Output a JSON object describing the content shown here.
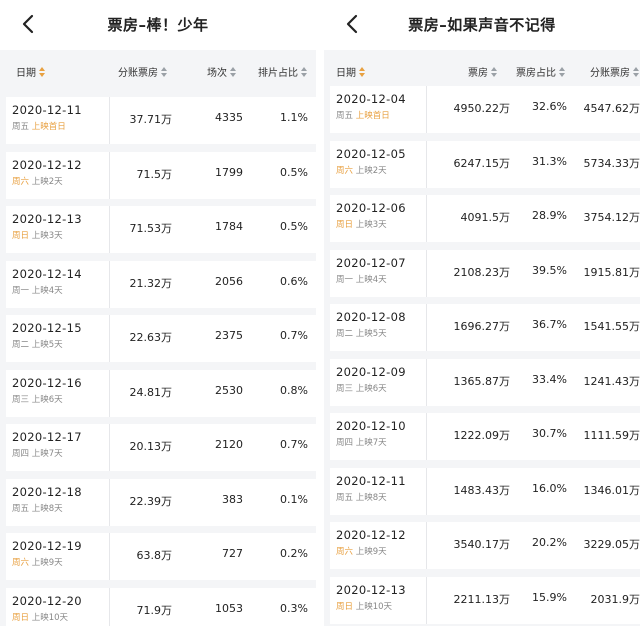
{
  "left": {
    "title": "票房–棒！少年",
    "headers": [
      "日期",
      "分账票房",
      "场次",
      "排片占比"
    ],
    "rows": [
      {
        "date": "2020-12-11",
        "weekday": "周五",
        "day": "上映首日",
        "weekend": false,
        "first": true,
        "c1": "37.71万",
        "c2": "4335",
        "c3": "1.1%"
      },
      {
        "date": "2020-12-12",
        "weekday": "周六",
        "day": "上映2天",
        "weekend": true,
        "first": false,
        "c1": "71.5万",
        "c2": "1799",
        "c3": "0.5%"
      },
      {
        "date": "2020-12-13",
        "weekday": "周日",
        "day": "上映3天",
        "weekend": true,
        "first": false,
        "c1": "71.53万",
        "c2": "1784",
        "c3": "0.5%"
      },
      {
        "date": "2020-12-14",
        "weekday": "周一",
        "day": "上映4天",
        "weekend": false,
        "first": false,
        "c1": "21.32万",
        "c2": "2056",
        "c3": "0.6%"
      },
      {
        "date": "2020-12-15",
        "weekday": "周二",
        "day": "上映5天",
        "weekend": false,
        "first": false,
        "c1": "22.63万",
        "c2": "2375",
        "c3": "0.7%"
      },
      {
        "date": "2020-12-16",
        "weekday": "周三",
        "day": "上映6天",
        "weekend": false,
        "first": false,
        "c1": "24.81万",
        "c2": "2530",
        "c3": "0.8%"
      },
      {
        "date": "2020-12-17",
        "weekday": "周四",
        "day": "上映7天",
        "weekend": false,
        "first": false,
        "c1": "20.13万",
        "c2": "2120",
        "c3": "0.7%"
      },
      {
        "date": "2020-12-18",
        "weekday": "周五",
        "day": "上映8天",
        "weekend": false,
        "first": false,
        "c1": "22.39万",
        "c2": "383",
        "c3": "0.1%"
      },
      {
        "date": "2020-12-19",
        "weekday": "周六",
        "day": "上映9天",
        "weekend": true,
        "first": false,
        "c1": "63.8万",
        "c2": "727",
        "c3": "0.2%"
      },
      {
        "date": "2020-12-20",
        "weekday": "周日",
        "day": "上映10天",
        "weekend": true,
        "first": false,
        "c1": "71.9万",
        "c2": "1053",
        "c3": "0.3%"
      }
    ]
  },
  "right": {
    "title": "票房–如果声音不记得",
    "headers": [
      "日期",
      "票房",
      "票房占比",
      "分账票房"
    ],
    "rows": [
      {
        "date": "2020-12-04",
        "weekday": "周五",
        "day": "上映首日",
        "weekend": false,
        "first": true,
        "c1": "4950.22万",
        "c2": "32.6%",
        "c3": "4547.62万"
      },
      {
        "date": "2020-12-05",
        "weekday": "周六",
        "day": "上映2天",
        "weekend": true,
        "first": false,
        "c1": "6247.15万",
        "c2": "31.3%",
        "c3": "5734.33万"
      },
      {
        "date": "2020-12-06",
        "weekday": "周日",
        "day": "上映3天",
        "weekend": true,
        "first": false,
        "c1": "4091.5万",
        "c2": "28.9%",
        "c3": "3754.12万"
      },
      {
        "date": "2020-12-07",
        "weekday": "周一",
        "day": "上映4天",
        "weekend": false,
        "first": false,
        "c1": "2108.23万",
        "c2": "39.5%",
        "c3": "1915.81万"
      },
      {
        "date": "2020-12-08",
        "weekday": "周二",
        "day": "上映5天",
        "weekend": false,
        "first": false,
        "c1": "1696.27万",
        "c2": "36.7%",
        "c3": "1541.55万"
      },
      {
        "date": "2020-12-09",
        "weekday": "周三",
        "day": "上映6天",
        "weekend": false,
        "first": false,
        "c1": "1365.87万",
        "c2": "33.4%",
        "c3": "1241.43万"
      },
      {
        "date": "2020-12-10",
        "weekday": "周四",
        "day": "上映7天",
        "weekend": false,
        "first": false,
        "c1": "1222.09万",
        "c2": "30.7%",
        "c3": "1111.59万"
      },
      {
        "date": "2020-12-11",
        "weekday": "周五",
        "day": "上映8天",
        "weekend": false,
        "first": false,
        "c1": "1483.43万",
        "c2": "16.0%",
        "c3": "1346.01万"
      },
      {
        "date": "2020-12-12",
        "weekday": "周六",
        "day": "上映9天",
        "weekend": true,
        "first": false,
        "c1": "3540.17万",
        "c2": "20.2%",
        "c3": "3229.05万"
      },
      {
        "date": "2020-12-13",
        "weekday": "周日",
        "day": "上映10天",
        "weekend": true,
        "first": false,
        "c1": "2211.13万",
        "c2": "15.9%",
        "c3": "2031.9万"
      }
    ]
  },
  "colors": {
    "accent": "#e8a040",
    "background": "#f4f5f7",
    "row": "#ffffff"
  }
}
